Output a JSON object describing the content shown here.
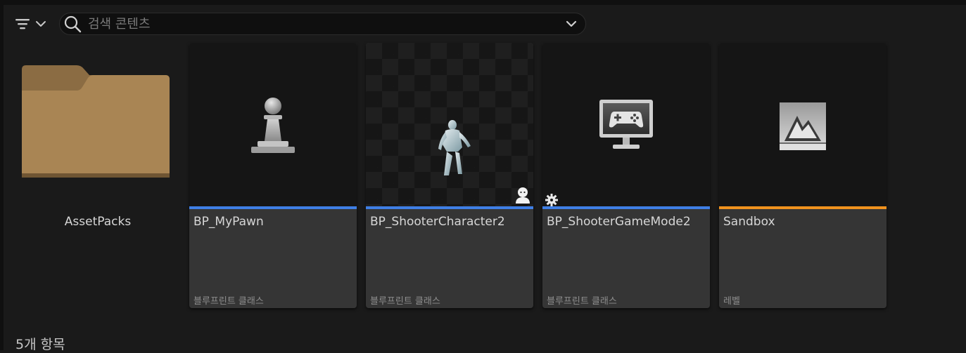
{
  "toolbar": {
    "filter_icon": "filter-icon",
    "search_placeholder": "검색 콘텐츠",
    "search_value": ""
  },
  "folder": {
    "name": "AssetPacks",
    "icon": "folder-icon",
    "color": "#a98554"
  },
  "assets": [
    {
      "name": "BP_MyPawn",
      "type": "블루프린트 클래스",
      "icon": "pawn-icon",
      "bar_color": "#3f7fe5"
    },
    {
      "name": "BP_ShooterCharacter2",
      "type": "블루프린트 클래스",
      "icon": "character-mannequin-icon",
      "badge": "character-badge-icon",
      "bar_color": "#3f7fe5"
    },
    {
      "name": "BP_ShooterGameMode2",
      "type": "블루프린트 클래스",
      "icon": "game-mode-monitor-icon",
      "badge": "cog-badge-icon",
      "bar_color": "#3f7fe5"
    },
    {
      "name": "Sandbox",
      "type": "레벨",
      "icon": "level-icon",
      "bar_color": "#f0921e"
    }
  ],
  "status": {
    "item_count": "5개 항목"
  }
}
